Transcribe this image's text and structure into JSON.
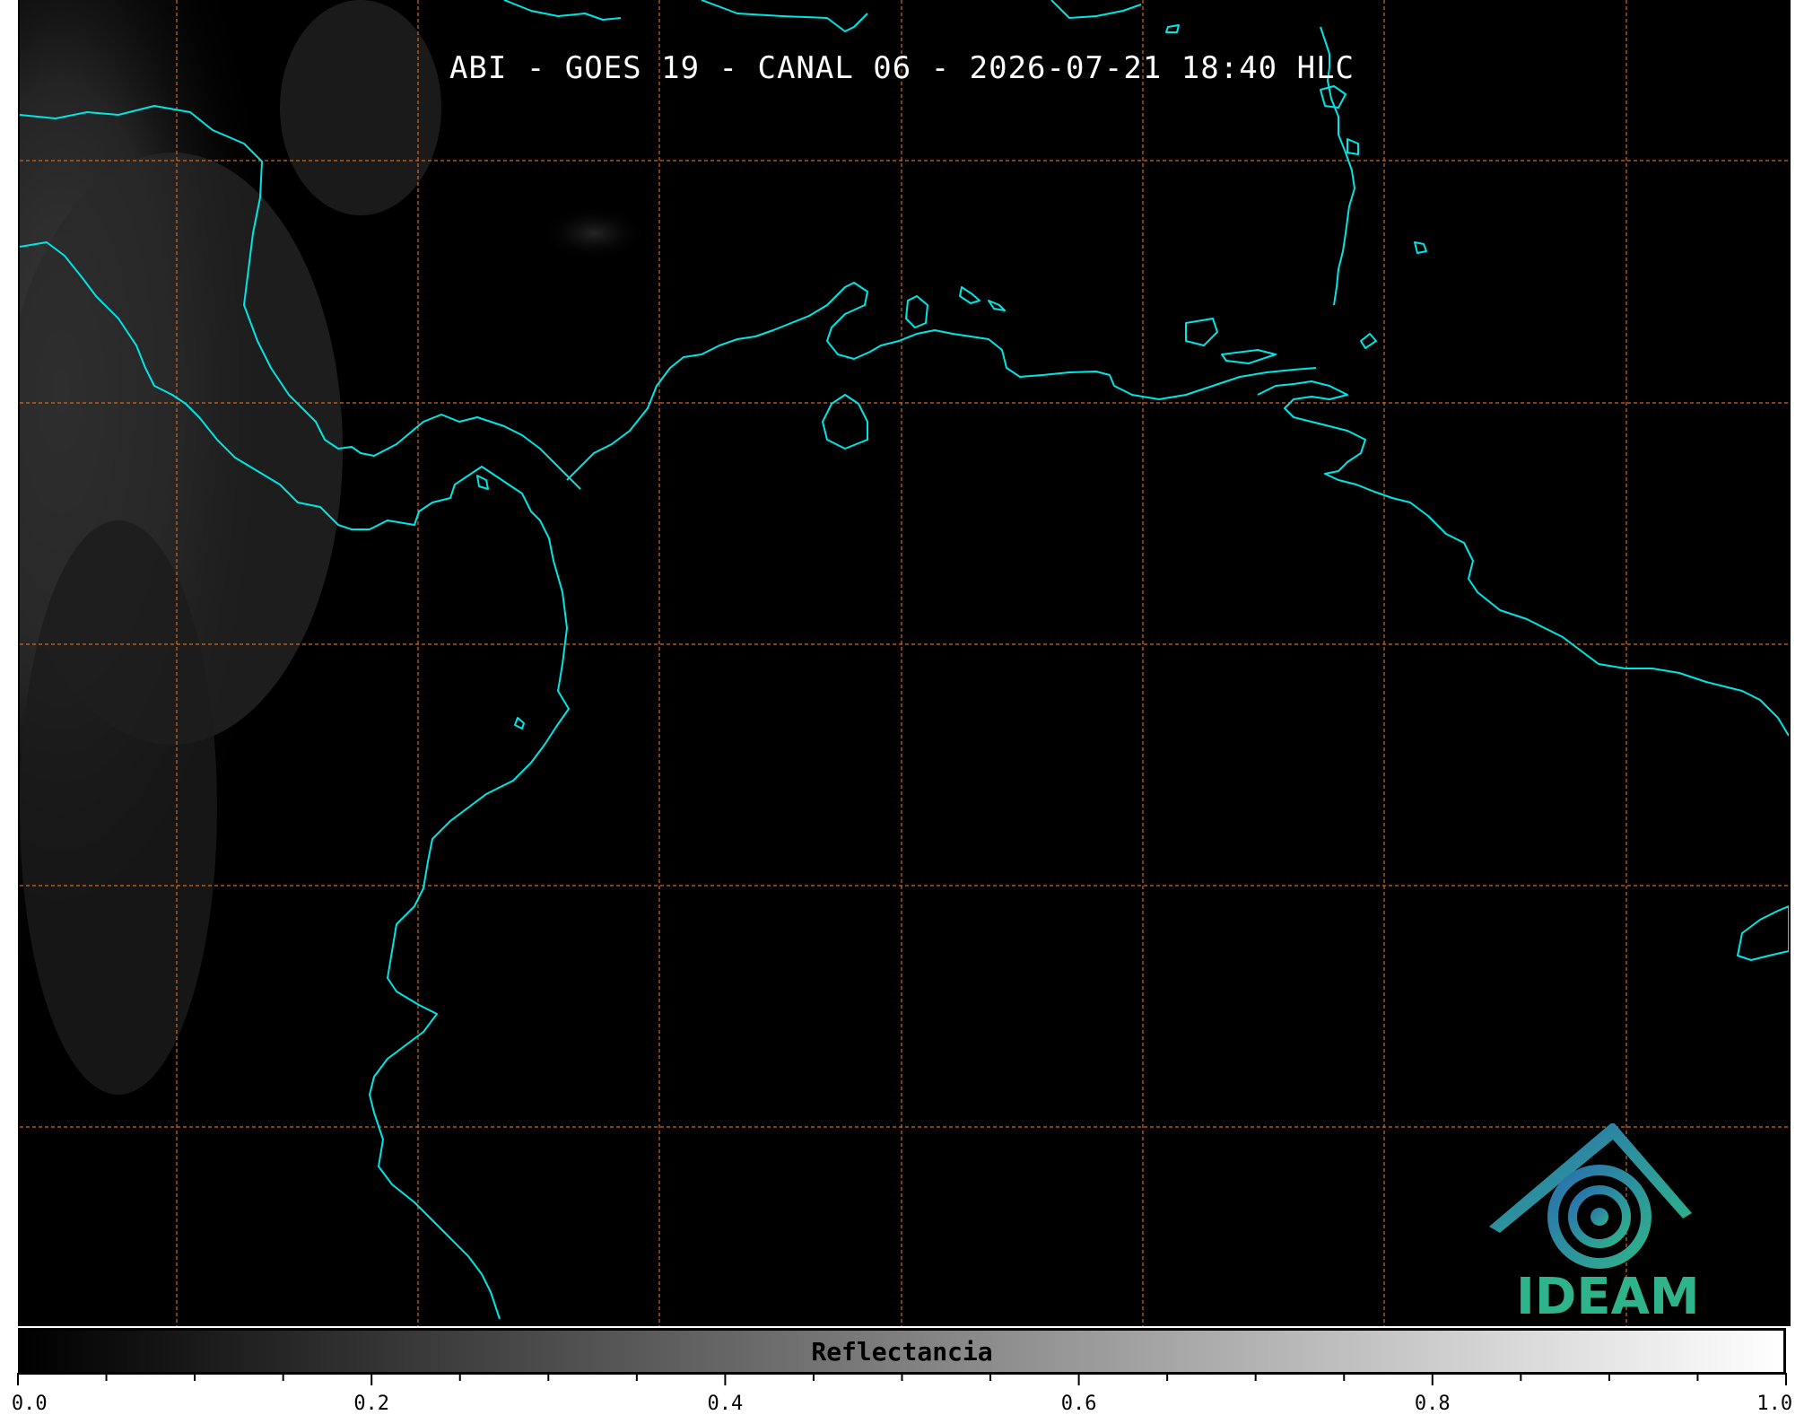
{
  "title": "ABI - GOES 19 - CANAL 06 - 2026-07-21 18:40 HLC",
  "logo": {
    "text": "IDEAM",
    "icon": "ideam-logo-icon"
  },
  "colorbar": {
    "label": "Reflectancia",
    "min": 0.0,
    "max": 1.0,
    "major_ticks": [
      "0.0",
      "0.2",
      "0.4",
      "0.6",
      "0.8",
      "1.0"
    ],
    "minor_tick_step": 0.05,
    "colors": [
      "#000000",
      "#ffffff"
    ]
  },
  "map": {
    "coastline_color": "#00e5e5",
    "grid_color": "#d2691e",
    "background_color": "#000000"
  }
}
